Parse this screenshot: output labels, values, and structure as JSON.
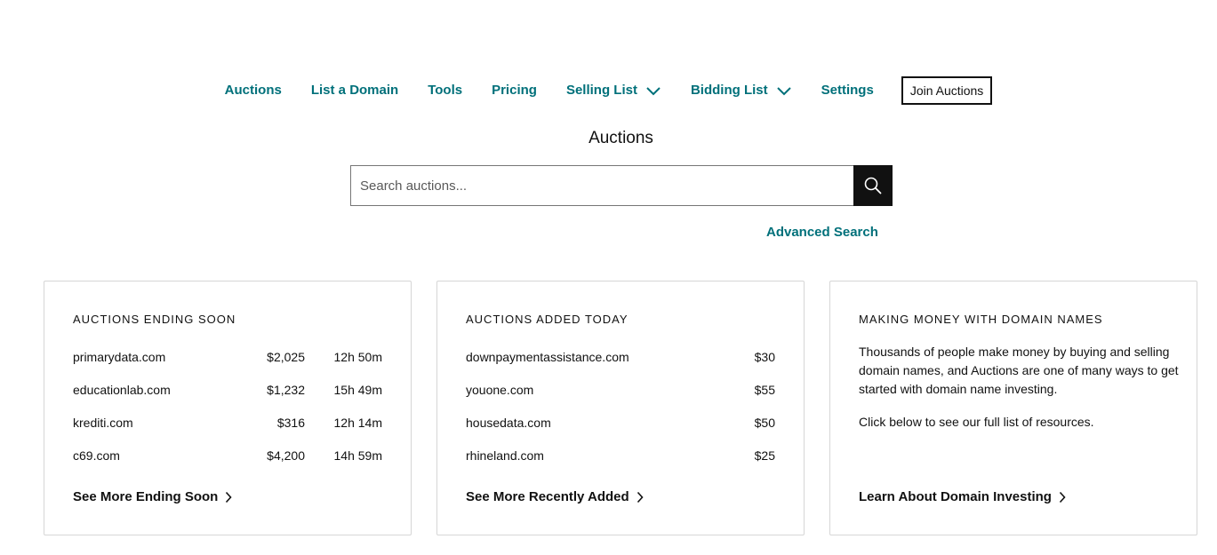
{
  "nav": {
    "items": [
      {
        "label": "Auctions"
      },
      {
        "label": "List a Domain"
      },
      {
        "label": "Tools"
      },
      {
        "label": "Pricing"
      },
      {
        "label": "Selling List"
      },
      {
        "label": "Bidding List"
      },
      {
        "label": "Settings"
      }
    ],
    "join_label": "Join Auctions"
  },
  "page_title": "Auctions",
  "search": {
    "placeholder": "Search auctions...",
    "value": "",
    "icon": "search-icon"
  },
  "advanced_search": "Advanced Search",
  "cards": {
    "ending_soon": {
      "heading": "AUCTIONS ENDING SOON",
      "rows": [
        {
          "domain": "primarydata.com",
          "price": "$2,025",
          "time": "12h 50m"
        },
        {
          "domain": "educationlab.com",
          "price": "$1,232",
          "time": "15h 49m"
        },
        {
          "domain": "krediti.com",
          "price": "$316",
          "time": "12h 14m"
        },
        {
          "domain": "c69.com",
          "price": "$4,200",
          "time": "14h 59m"
        }
      ],
      "link": "See More Ending Soon"
    },
    "added_today": {
      "heading": "AUCTIONS ADDED TODAY",
      "rows": [
        {
          "domain": "downpaymentassistance.com",
          "price": "$30"
        },
        {
          "domain": "youone.com",
          "price": "$55"
        },
        {
          "domain": "housedata.com",
          "price": "$50"
        },
        {
          "domain": "rhineland.com",
          "price": "$25"
        }
      ],
      "link": "See More Recently Added"
    },
    "making_money": {
      "heading": "MAKING MONEY WITH DOMAIN NAMES",
      "paragraph1": "Thousands of people make money by buying and selling domain names, and Auctions are one of many ways to get started with domain name investing.",
      "paragraph2": "Click below to see our full list of resources.",
      "link": "Learn About Domain Investing"
    }
  },
  "colors": {
    "accent": "#00707a",
    "text": "#111111",
    "border": "#d6d6d6"
  }
}
